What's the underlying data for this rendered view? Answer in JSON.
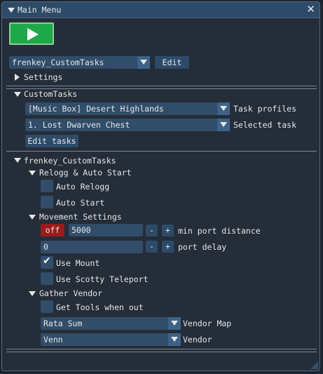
{
  "window": {
    "title": "Main Menu"
  },
  "profile": {
    "selected": "frenkey_CustomTasks",
    "edit_label": "Edit"
  },
  "settings_label": "Settings",
  "custom_tasks": {
    "header": "CustomTasks",
    "task_profile_value": "[Music Box] Desert Highlands",
    "task_profile_label": "Task profiles",
    "selected_task_value": "1. Lost Dwarven Chest",
    "selected_task_label": "Selected task",
    "edit_tasks_label": "Edit tasks"
  },
  "profile_section": {
    "header": "frenkey_CustomTasks",
    "relogg": {
      "header": "Relogg & Auto Start",
      "auto_relogg": {
        "label": "Auto Relogg",
        "checked": false
      },
      "auto_start": {
        "label": "Auto Start",
        "checked": false
      }
    },
    "movement": {
      "header": "Movement Settings",
      "off_label": "off",
      "min_port_distance": {
        "value": "5000",
        "label": "min port distance"
      },
      "port_delay": {
        "value": "0",
        "label": "port delay"
      },
      "minus": "-",
      "plus": "+",
      "use_mount": {
        "label": "Use Mount",
        "checked": true,
        "check": "✔"
      },
      "use_scotty": {
        "label": "Use Scotty Teleport",
        "checked": false
      }
    },
    "vendor": {
      "header": "Gather Vendor",
      "get_tools": {
        "label": "Get Tools when out",
        "checked": false
      },
      "vendor_map_value": "Rata Sum",
      "vendor_map_label": "Vendor Map",
      "vendor_value": "Venn",
      "vendor_label": "Vendor"
    }
  },
  "close_glyph": "✕",
  "colors": {
    "title_bar": "#2d4b69",
    "window_bg": "#252d38",
    "widget": "#314d6a",
    "play_button": "#1fa84a",
    "off_button": "#9c1a1a"
  }
}
